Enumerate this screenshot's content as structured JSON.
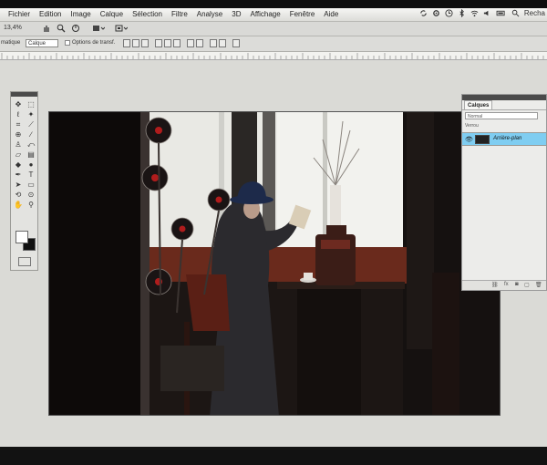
{
  "menubar": {
    "items": [
      "Fichier",
      "Edition",
      "Image",
      "Calque",
      "Sélection",
      "Filtre",
      "Analyse",
      "3D",
      "Affichage",
      "Fenêtre",
      "Aide"
    ],
    "user": "Recha"
  },
  "options": {
    "zoom": "13,4%",
    "auto_select_label": "matique",
    "auto_select_value": "Calque",
    "transform_label": "Options de transf."
  },
  "layers_panel": {
    "tab": "Calques",
    "blend_mode": "Normal",
    "lock_label": "Verrou",
    "layer_name": "Arrière-plan",
    "footer": "fx"
  },
  "colors": {
    "accent": "#7fcdf1",
    "foreground": "#ffffff",
    "background": "#111111"
  }
}
